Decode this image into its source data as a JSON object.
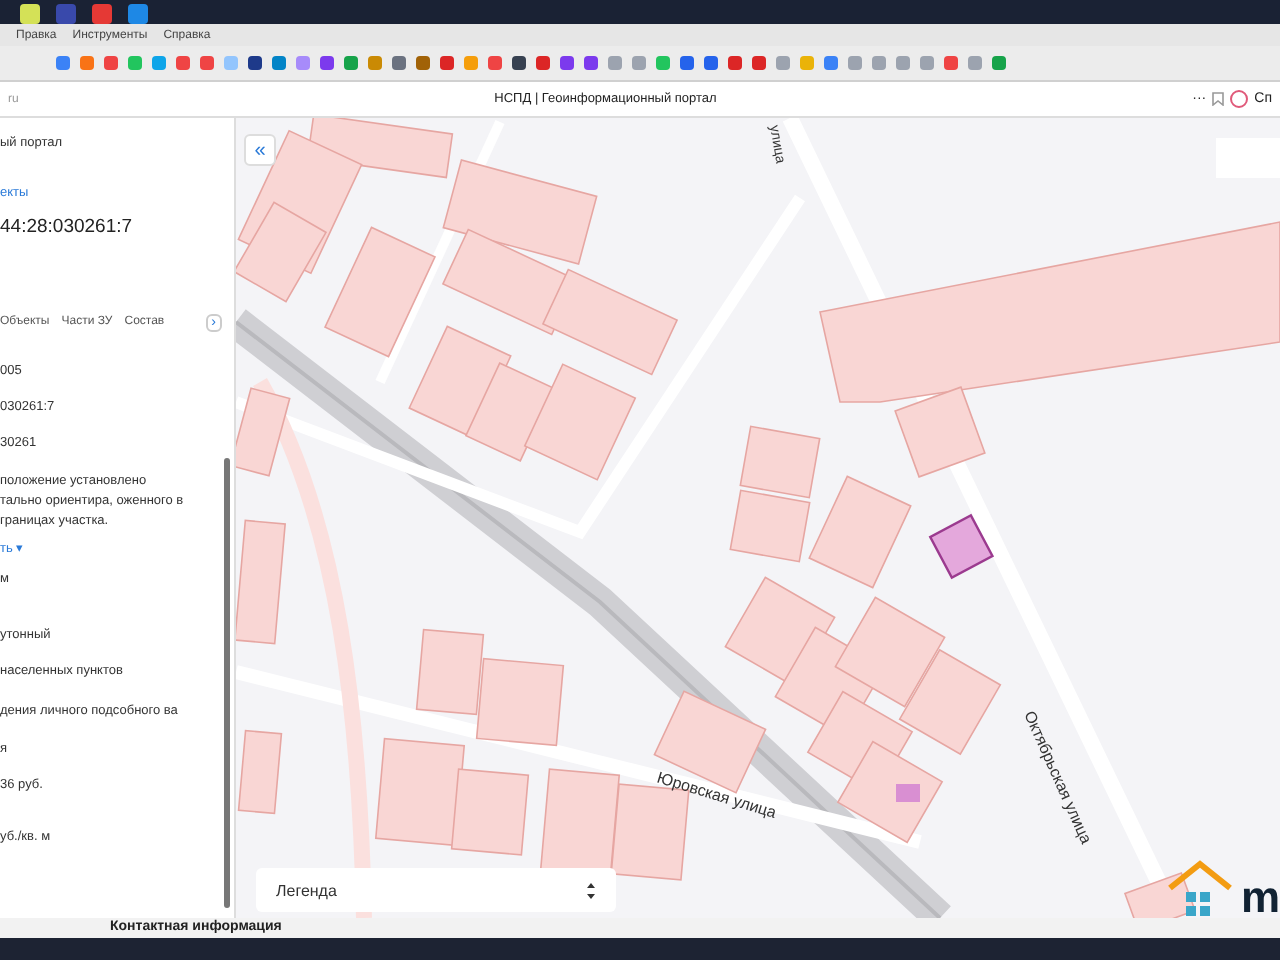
{
  "menu_bar": {
    "items": [
      "Правка",
      "Инструменты",
      "Справка"
    ]
  },
  "address_bar": {
    "url": "ru",
    "page_title": "НСПД | Геоинформационный портал",
    "more": "···",
    "profile": "Сп"
  },
  "panel": {
    "header_title": "ый портал",
    "link": "екты",
    "cadastral_number": "44:28:030261:7",
    "tabs": [
      {
        "label": "Объекты",
        "selected": false
      },
      {
        "label": "Части ЗУ",
        "selected": false
      },
      {
        "label": "Состав",
        "selected": false
      }
    ],
    "tabs_next": "›",
    "fields": [
      {
        "kind": "text",
        "text": "005"
      },
      {
        "kind": "text",
        "text": "030261:7"
      },
      {
        "kind": "text",
        "text": "30261"
      },
      {
        "kind": "text",
        "text": "положение установлено тально ориентира, оженного в границах участка."
      },
      {
        "kind": "link",
        "text": "ть ▾"
      },
      {
        "kind": "text",
        "text": "м"
      },
      {
        "kind": "text",
        "text": "утонный"
      },
      {
        "kind": "text",
        "text": "населенных пунктов"
      },
      {
        "kind": "text",
        "text": "дения личного подсобного ва"
      },
      {
        "kind": "text",
        "text": "я"
      },
      {
        "kind": "text",
        "text": "36 руб."
      },
      {
        "kind": "text",
        "text": "уб./кв. м"
      }
    ]
  },
  "map": {
    "collapse_button": "«",
    "street_labels": [
      {
        "text": "улица"
      },
      {
        "text": "Юровская улица"
      },
      {
        "text": "Октябрьская улица"
      }
    ],
    "legend": {
      "label": "Легенда"
    },
    "logo_text": "m"
  },
  "footer": {
    "text": "Контактная информация"
  }
}
